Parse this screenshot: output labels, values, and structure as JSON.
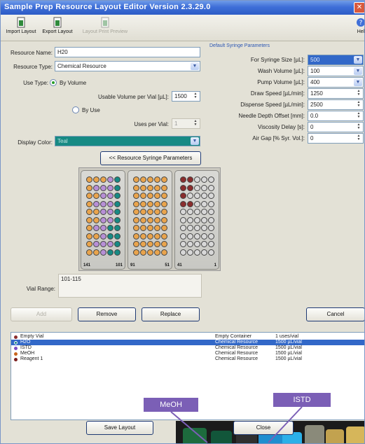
{
  "window": {
    "title": "Sample Prep Resource Layout Editor Version 2.3.29.0",
    "close_glyph": "✕"
  },
  "toolbar": {
    "import_label": "Import Layout",
    "export_label": "Export Layout",
    "preview_label": "Layout Print Preview",
    "help_label": "Hel"
  },
  "form": {
    "resource_name_label": "Resource Name:",
    "resource_name_value": "H20",
    "resource_type_label": "Resource Type:",
    "resource_type_value": "Chemical Resource",
    "use_type_label": "Use Type:",
    "by_volume_label": "By Volume",
    "usable_volume_label": "Usable Volume per Vial [µL]:",
    "usable_volume_value": "1500",
    "by_use_label": "By Use",
    "uses_per_vial_label": "Uses per Vial:",
    "uses_per_vial_value": "1",
    "display_color_label": "Display Color:",
    "display_color_value": "Teal",
    "display_color_hex": "#178a84",
    "syringe_button_label": "<< Resource Syringe Parameters",
    "vial_range_label": "Vial Range:",
    "vial_range_value": "101-115"
  },
  "syringe": {
    "group_title": "Default Syringe Parameters",
    "params": [
      {
        "label": "For Syringe Size [µL]:",
        "value": "500"
      },
      {
        "label": "Wash Volume [µL]:",
        "value": "100"
      },
      {
        "label": "Pump Volume [µL]:",
        "value": "400"
      },
      {
        "label": "Draw Speed [µL/min]:",
        "value": "1250"
      },
      {
        "label": "Dispense Speed [µL/min]:",
        "value": "2500"
      },
      {
        "label": "Needle Depth Offset [mm]:",
        "value": "0.0"
      },
      {
        "label": "Viscosity Delay [s]:",
        "value": "0"
      },
      {
        "label": "Air Gap [% Syr. Vol.]:",
        "value": "0"
      }
    ]
  },
  "racks": [
    {
      "label_left": "141",
      "label_right": "101"
    },
    {
      "label_left": "91",
      "label_right": "51"
    },
    {
      "label_left": "41",
      "label_right": "1"
    }
  ],
  "colors": {
    "teal": "#178a84",
    "purple": "#b78fd6",
    "orange": "#e9a44d",
    "brown": "#8a2d2d",
    "empty": "#d8d8d8"
  },
  "buttons": {
    "add": "Add",
    "remove": "Remove",
    "replace": "Replace",
    "cancel": "Cancel",
    "save_layout": "Save Layout",
    "close": "Close"
  },
  "resources": [
    {
      "name": "Empty Vial",
      "type": "Empty Container",
      "usage": "1 uses/vial",
      "color": "#8a2d2d",
      "selected": false
    },
    {
      "name": "H2O",
      "type": "Chemical Resource",
      "usage": "1500 µL/vial",
      "color": "#178a84",
      "selected": true
    },
    {
      "name": "ISTD",
      "type": "Chemical Resource",
      "usage": "1500 µL/vial",
      "color": "#7d4fc4",
      "selected": false
    },
    {
      "name": "MeOH",
      "type": "Chemical Resource",
      "usage": "1500 µL/vial",
      "color": "#c8651e",
      "selected": false
    },
    {
      "name": "Reagent 1",
      "type": "Chemical Resource",
      "usage": "1500 µL/vial",
      "color": "#7a1c1c",
      "selected": false
    }
  ],
  "callouts": {
    "meoh": "MeOH",
    "istd": "ISTD"
  }
}
